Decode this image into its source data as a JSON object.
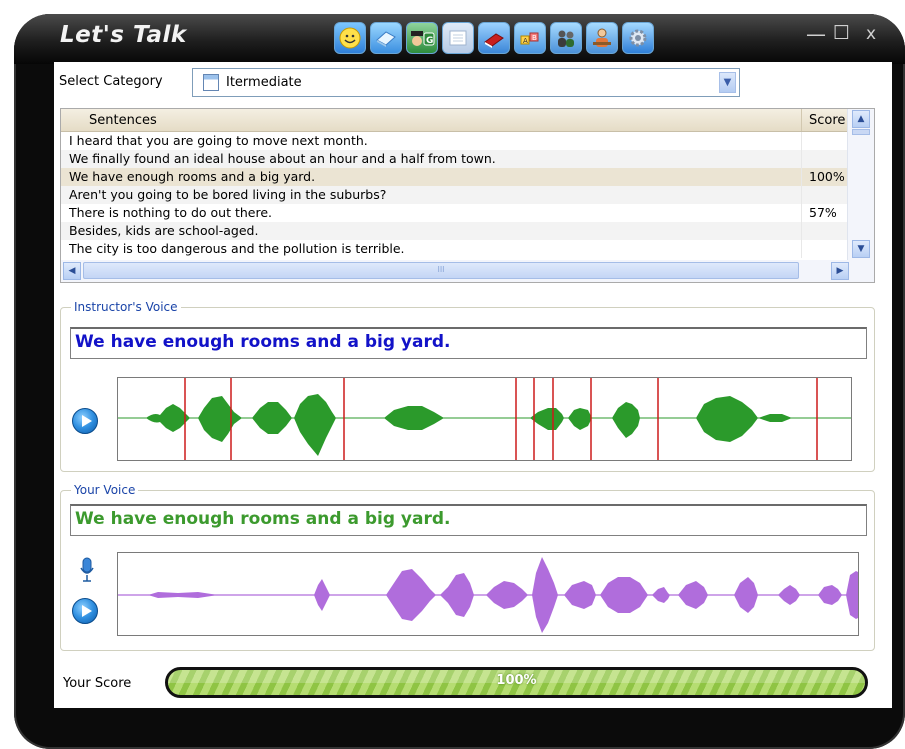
{
  "window": {
    "title": "Let's Talk",
    "toolbar_icons": [
      "smiley-icon",
      "book-icon",
      "graduate-icon",
      "notepad-icon",
      "red-book-icon",
      "abc-blocks-icon",
      "people-icon",
      "teacher-icon",
      "settings-icon"
    ],
    "controls": {
      "minimize": "—",
      "maximize": "☐",
      "close": "x"
    }
  },
  "category": {
    "label": "Select Category",
    "value": "Itermediate"
  },
  "sentences": {
    "headers": {
      "sentence": "Sentences",
      "score": "Score"
    },
    "rows": [
      {
        "text": "I heard that you are going to move next month.",
        "score": ""
      },
      {
        "text": "We finally found an ideal house about an hour and a half from town.",
        "score": ""
      },
      {
        "text": "We have enough rooms and a big yard.",
        "score": "100%"
      },
      {
        "text": "Aren't you going to be bored living in the suburbs?",
        "score": ""
      },
      {
        "text": "There is nothing to do out there.",
        "score": "57%"
      },
      {
        "text": "Besides, kids are school-aged.",
        "score": ""
      },
      {
        "text": "The city is too dangerous and the pollution is terrible.",
        "score": ""
      }
    ],
    "selected_index": 2,
    "hscroll_grip": "III"
  },
  "instructor": {
    "legend": "Instructor's Voice",
    "text": "We have enough rooms and a big yard.",
    "text_color": "#1212c8",
    "wave_color": "#2b9a2b",
    "marker_color": "#cc1a1a"
  },
  "user": {
    "legend": "Your Voice",
    "text": "We have enough rooms and a big yard.",
    "text_color": "#3c9a2e",
    "wave_color": "#b06ddc"
  },
  "score": {
    "label": "Your Score",
    "value": "100%",
    "fraction": 1.0,
    "bar_color": "#9fd053"
  }
}
